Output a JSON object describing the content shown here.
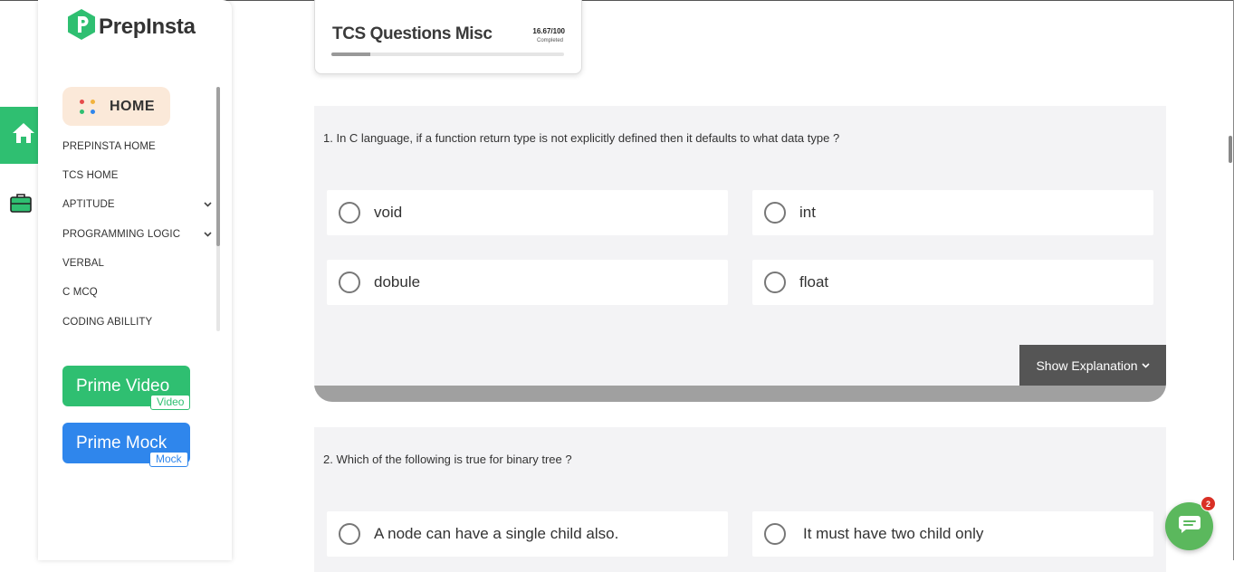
{
  "brand": {
    "name": "PrepInsta",
    "color": "#2fbf71"
  },
  "rail": {
    "home_icon": "home-icon",
    "briefcase_icon": "briefcase-icon"
  },
  "sidebar": {
    "home_label": "HOME",
    "items": [
      {
        "label": "PREPINSTA HOME",
        "has_dropdown": false
      },
      {
        "label": "TCS HOME",
        "has_dropdown": false
      },
      {
        "label": "APTITUDE",
        "has_dropdown": true
      },
      {
        "label": "PROGRAMMING LOGIC",
        "has_dropdown": true
      },
      {
        "label": "VERBAL",
        "has_dropdown": false
      },
      {
        "label": "C MCQ",
        "has_dropdown": false
      },
      {
        "label": "CODING ABILLITY",
        "has_dropdown": false
      }
    ],
    "prime_video": {
      "label": "Prime Video",
      "tag": "Video",
      "color": "#2fbf71"
    },
    "prime_mock": {
      "label": "Prime Mock",
      "tag": "Mock",
      "color": "#2f86ec"
    }
  },
  "progress": {
    "title": "TCS Questions Misc",
    "score": "16.67/100",
    "status": "Completed",
    "fraction": 0.1667
  },
  "questions": [
    {
      "text": "1. In C language, if a function return type is not explicitly defined then it defaults to what data type ?",
      "options": [
        "void",
        "int",
        "dobule",
        "float"
      ],
      "explanation_button": "Show Explanation"
    },
    {
      "text": "2. Which of the following is true for binary tree ?",
      "options": [
        "A node can have a single child also.",
        "It must have two child only"
      ]
    }
  ],
  "chat": {
    "badge": "2",
    "icon": "chat-bubble-icon"
  }
}
